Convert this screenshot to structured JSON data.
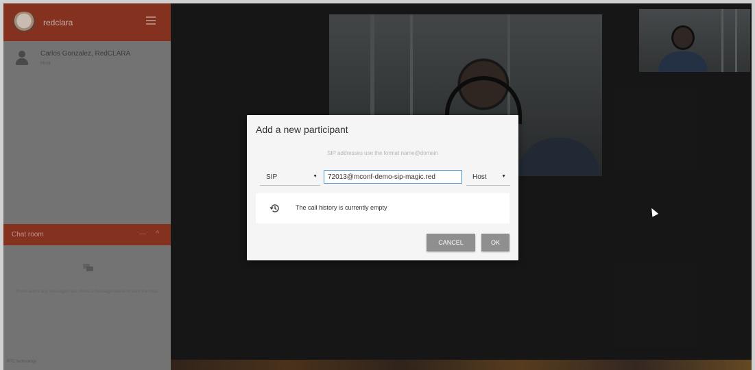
{
  "sidebar": {
    "brand": "redclara",
    "participant": {
      "name": "Carlos Gonzalez, RedCLARA",
      "status": "Host"
    },
    "chat": {
      "title": "Chat room",
      "ctrl_minimize": "—",
      "ctrl_collapse": "^",
      "empty_message": "There aren't any messages yet. Write a message below to start the chat."
    },
    "footer": "RTC technology"
  },
  "dialog": {
    "title": "Add a new participant",
    "hint": "SIP addresses use the format name@domain",
    "protocol": "SIP",
    "address": "72013@mconf-demo-sip-magic.red",
    "role": "Host",
    "history_text": "The call history is currently empty",
    "cancel_label": "CANCEL",
    "ok_label": "OK"
  },
  "icons": {
    "menu": "hamburger-menu-icon",
    "history": "history-icon",
    "chat": "chat-bubbles-icon",
    "avatar": "person-avatar-icon",
    "cursor": "mouse-cursor-icon"
  },
  "colors": {
    "accent": "#a13c27",
    "dialog_bg": "#f5f5f5",
    "button": "#8f8f8f",
    "input_focus": "#4a8fd1"
  }
}
